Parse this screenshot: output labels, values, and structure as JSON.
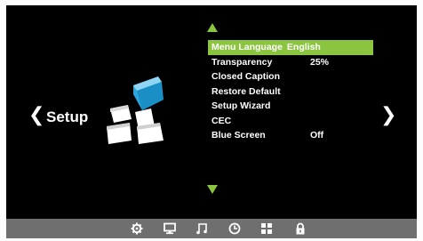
{
  "header": {
    "title": "Setup",
    "prev_icon": "chevron-left-icon",
    "next_icon": "chevron-right-icon"
  },
  "menu": {
    "items": [
      {
        "label": "Menu Language",
        "value": "English",
        "selected": true
      },
      {
        "label": "Transparency",
        "value": "25%"
      },
      {
        "label": "Closed Caption",
        "value": ""
      },
      {
        "label": "Restore Default",
        "value": ""
      },
      {
        "label": "Setup Wizard",
        "value": ""
      },
      {
        "label": "CEC",
        "value": ""
      },
      {
        "label": "Blue Screen",
        "value": "Off"
      }
    ]
  },
  "bottom_bar": {
    "icons": [
      "gear-icon",
      "monitor-icon",
      "music-note-icon",
      "clock-icon",
      "grid-icon",
      "lock-icon"
    ],
    "active": "grid-icon"
  },
  "colors": {
    "accent": "#8bc53f",
    "background": "#000000",
    "bar": "#6f6f6f"
  }
}
